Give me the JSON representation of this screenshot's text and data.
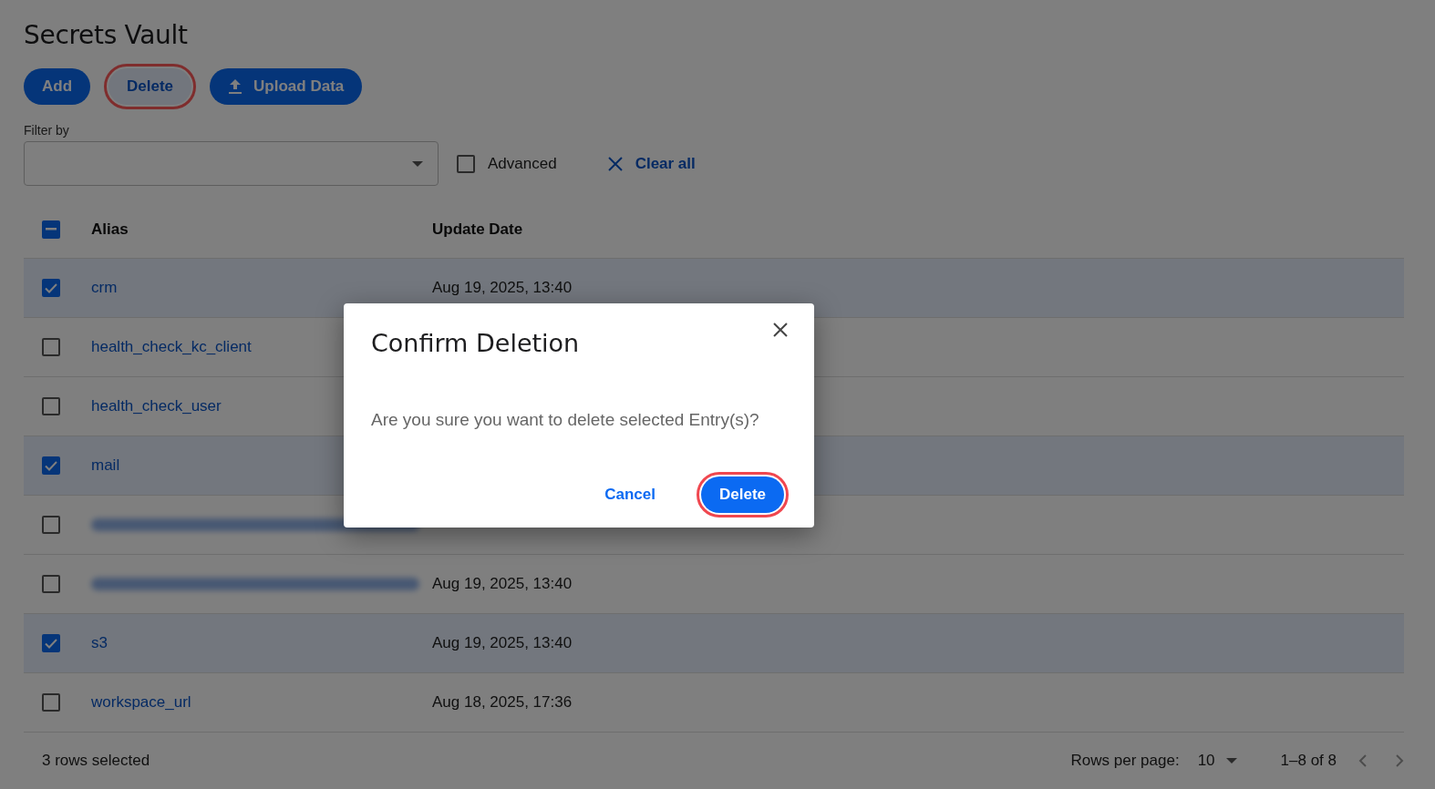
{
  "title": "Secrets Vault",
  "toolbar": [
    {
      "kind": "primary",
      "label": "Add",
      "highlighted": false
    },
    {
      "kind": "tonal",
      "label": "Delete",
      "highlighted": true
    },
    {
      "kind": "upload",
      "label": "Upload Data",
      "highlighted": false
    }
  ],
  "filter": {
    "label": "Filter by",
    "advanced": {
      "label": "Advanced",
      "checked": false
    },
    "clear": "Clear all"
  },
  "table": {
    "select_all": {
      "indeterminate": true
    },
    "columns": [
      "Alias",
      "Update Date"
    ],
    "rows": [
      {
        "alias": "crm",
        "date": "Aug 19, 2025, 13:40",
        "selected": true
      },
      {
        "alias": "health_check_kc_client",
        "selected": false
      },
      {
        "alias": "health_check_user",
        "selected": false
      },
      {
        "alias": "mail",
        "selected": true
      },
      {
        "redacted": true,
        "selected": false
      },
      {
        "redacted": true,
        "date": "Aug 19, 2025, 13:40",
        "selected": false
      },
      {
        "alias": "s3",
        "date": "Aug 19, 2025, 13:40",
        "selected": true
      },
      {
        "alias": "workspace_url",
        "date": "Aug 18, 2025, 17:36",
        "selected": false
      }
    ]
  },
  "footer": {
    "selection": "3 rows selected",
    "rows_per_page_label": "Rows per page:",
    "rows_per_page": "10",
    "range": "1–8 of 8"
  },
  "dialog": {
    "title": "Confirm Deletion",
    "message": "Are you sure you want to delete selected Entry(s)?",
    "buttons": [
      {
        "kind": "text",
        "label": "Cancel",
        "highlighted": false
      },
      {
        "kind": "filled",
        "label": "Delete",
        "highlighted": true
      }
    ]
  }
}
